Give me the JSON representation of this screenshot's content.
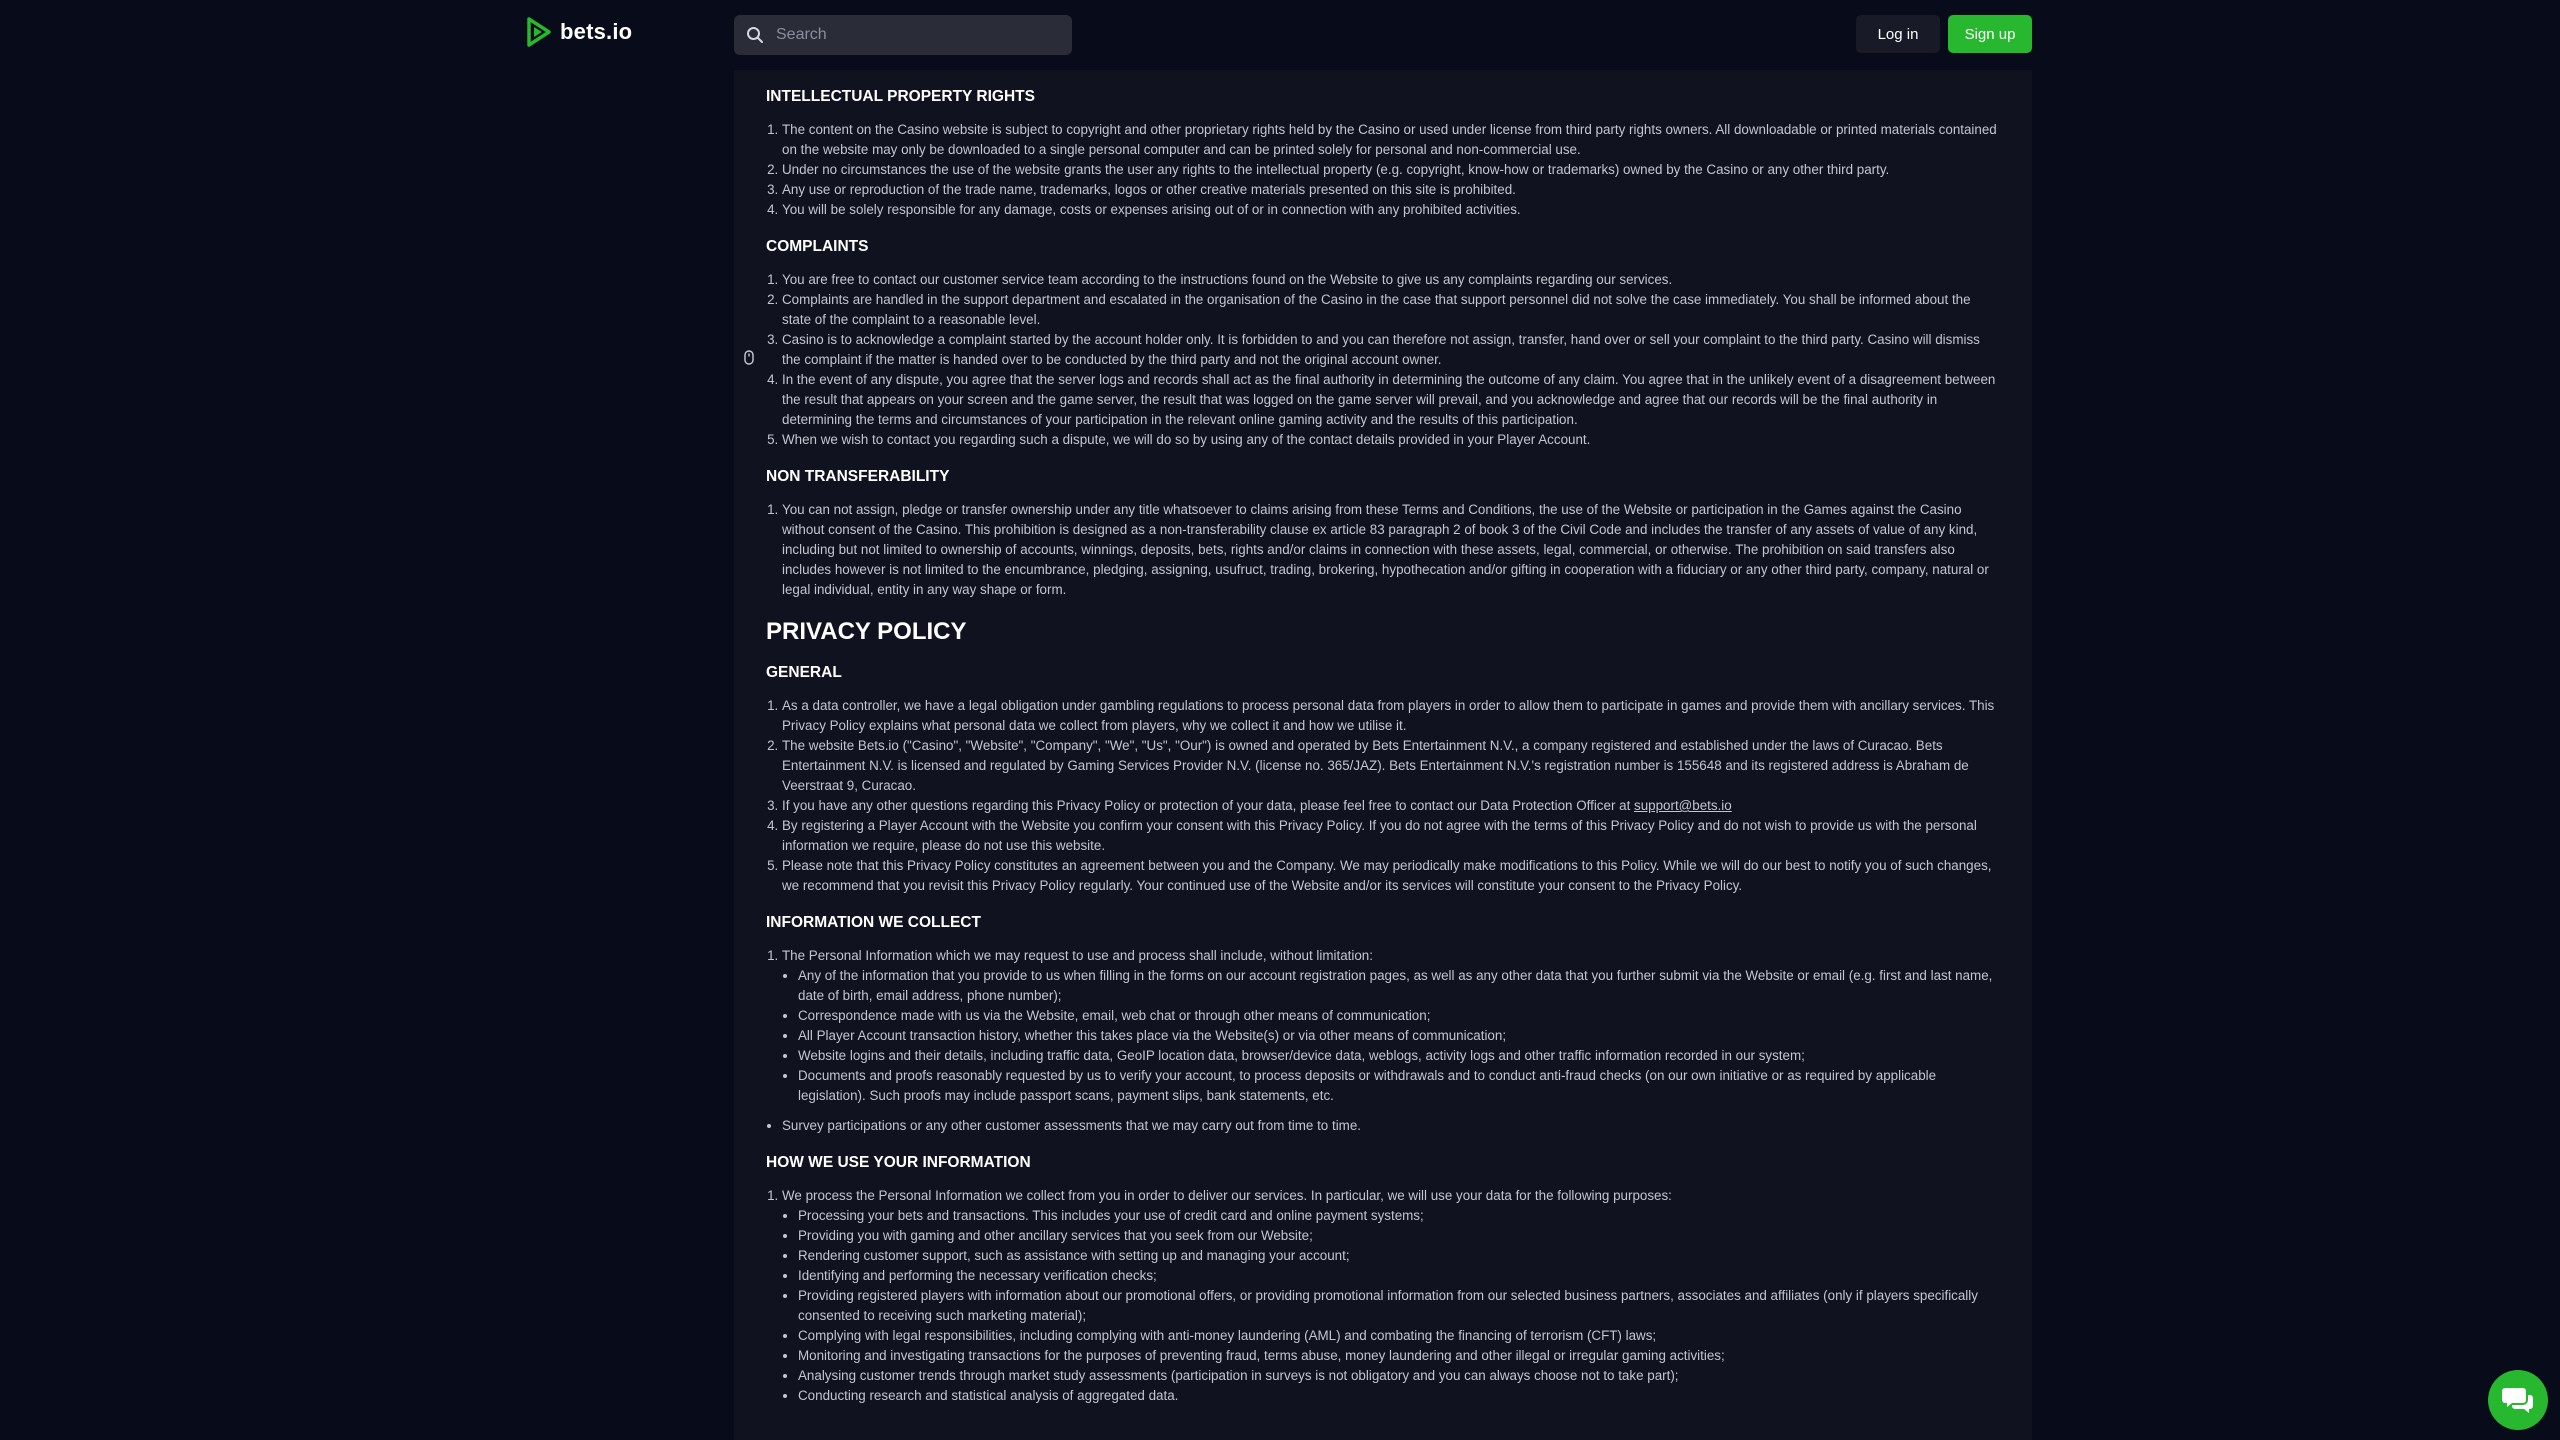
{
  "header": {
    "logo_text": "bets.io",
    "search_placeholder": "Search",
    "login_label": "Log in",
    "signup_label": "Sign up"
  },
  "colors": {
    "background": "#080b1a",
    "content_bg": "#10131f",
    "accent_green": "#27b82f"
  },
  "sections": {
    "ip": {
      "title": "INTELLECTUAL PROPERTY RIGHTS",
      "items": [
        "The content on the Casino website is subject to copyright and other proprietary rights held by the Casino or used under license from third party rights owners. All downloadable or printed materials contained on the website may only be downloaded to a single personal computer and can be printed solely for personal and non-commercial use.",
        "Under no circumstances the use of the website grants the user any rights to the intellectual property (e.g. copyright, know-how or trademarks) owned by the Casino or any other third party.",
        "Any use or reproduction of the trade name, trademarks, logos or other creative materials presented on this site is prohibited.",
        "You will be solely responsible for any damage, costs or expenses arising out of or in connection with any prohibited activities."
      ]
    },
    "complaints": {
      "title": "COMPLAINTS",
      "items": [
        "You are free to contact our customer service team according to the instructions found on the Website to give us any complaints regarding our services.",
        "Complaints are handled in the support department and escalated in the organisation of the Casino in the case that support personnel did not solve the case immediately. You shall be informed about the state of the complaint to a reasonable level.",
        "Casino is to acknowledge a complaint started by the account holder only. It is forbidden to and you can therefore not assign, transfer, hand over or sell your complaint to the third party. Casino will dismiss the complaint if the matter is handed over to be conducted by the third party and not the original account owner.",
        "In the event of any dispute, you agree that the server logs and records shall act as the final authority in determining the outcome of any claim. You agree that in the unlikely event of a disagreement between the result that appears on your screen and the game server, the result that was logged on the game server will prevail, and you acknowledge and agree that our records will be the final authority in determining the terms and circumstances of your participation in the relevant online gaming activity and the results of this participation.",
        "When we wish to contact you regarding such a dispute, we will do so by using any of the contact details provided in your Player Account."
      ]
    },
    "non_transfer": {
      "title": "NON TRANSFERABILITY",
      "items": [
        "You can not assign, pledge or transfer ownership under any title whatsoever to claims arising from these Terms and Conditions, the use of the Website or participation in the Games against the Casino without consent of the Casino. This prohibition is designed as a non-transferability clause ex article 83 paragraph 2 of book 3 of the Civil Code and includes the transfer of any assets of value of any kind, including but not limited to ownership of accounts, winnings, deposits, bets, rights and/or claims in connection with these assets, legal, commercial, or otherwise. The prohibition on said transfers also includes however is not limited to the encumbrance, pledging, assigning, usufruct, trading, brokering, hypothecation and/or gifting in cooperation with a fiduciary or any other third party, company, natural or legal individual, entity in any way shape or form."
      ]
    },
    "privacy_title": "PRIVACY POLICY",
    "general": {
      "title": "GENERAL",
      "items": [
        "As a data controller, we have a legal obligation under gambling regulations to process personal data from players in order to allow them to participate in games and provide them with ancillary services. This Privacy Policy explains what personal data we collect from players, why we collect it and how we utilise it.",
        "The website Bets.io (\"Casino\", \"Website\", \"Company\", \"We\", \"Us\", \"Our\") is owned and operated by Bets Entertainment N.V., a company registered and established under the laws of Curacao. Bets Entertainment N.V. is licensed and regulated by Gaming Services Provider N.V. (license no. 365/JAZ). Bets Entertainment N.V.'s registration number is 155648 and its registered address is Abraham de Veerstraat 9, Curacao."
      ],
      "item3_text": "If you have any other questions regarding this Privacy Policy or protection of your data, please feel free to contact our Data Protection Officer at ",
      "item3_link": "support@bets.io",
      "items_after": [
        "By registering a Player Account with the Website you confirm your consent with this Privacy Policy. If you do not agree with the terms of this Privacy Policy and do not wish to provide us with the personal information we require, please do not use this website.",
        "Please note that this Privacy Policy constitutes an agreement between you and the Company. We may periodically make modifications to this Policy. While we will do our best to notify you of such changes, we recommend that you revisit this Privacy Policy regularly. Your continued use of the Website and/or its services will constitute your consent to the Privacy Policy."
      ]
    },
    "collect": {
      "title": "INFORMATION WE COLLECT",
      "intro": "The Personal Information which we may request to use and process shall include, without limitation:",
      "bullets": [
        "Any of the information that you provide to us when filling in the forms on our account registration pages, as well as any other data that you further submit via the Website or email (e.g. first and last name, date of birth, email address, phone number);",
        "Correspondence made with us via the Website, email, web chat or through other means of communication;",
        "All Player Account transaction history, whether this takes place via the Website(s) or via other means of communication;",
        "Website logins and their details, including traffic data, GeoIP location data, browser/device data, weblogs, activity logs and other traffic information recorded in our system;",
        "Documents and proofs reasonably requested by us to verify your account, to process deposits or withdrawals and to conduct anti-fraud checks (on our own initiative or as required by applicable legislation). Such proofs may include passport scans, payment slips, bank statements, etc."
      ],
      "extra": "Survey participations or any other customer assessments that we may carry out from time to time."
    },
    "use": {
      "title": "HOW WE USE YOUR INFORMATION",
      "intro": "We process the Personal Information we collect from you in order to deliver our services. In particular, we will use your data for the following purposes:",
      "bullets": [
        "Processing your bets and transactions. This includes your use of credit card and online payment systems;",
        "Providing you with gaming and other ancillary services that you seek from our Website;",
        "Rendering customer support, such as assistance with setting up and managing your account;",
        "Identifying and performing the necessary verification checks;",
        "Providing registered players with information about our promotional offers, or providing promotional information from our selected business partners, associates and affiliates (only if players specifically consented to receiving such marketing material);",
        "Complying with legal responsibilities, including complying with anti-money laundering (AML) and combating the financing of terrorism (CFT) laws;",
        "Monitoring and investigating transactions for the purposes of preventing fraud, terms abuse, money laundering and other illegal or irregular gaming activities;",
        "Analysing customer trends through market study assessments (participation in surveys is not obligatory and you can always choose not to take part);",
        "Conducting research and statistical analysis of aggregated data."
      ]
    }
  }
}
